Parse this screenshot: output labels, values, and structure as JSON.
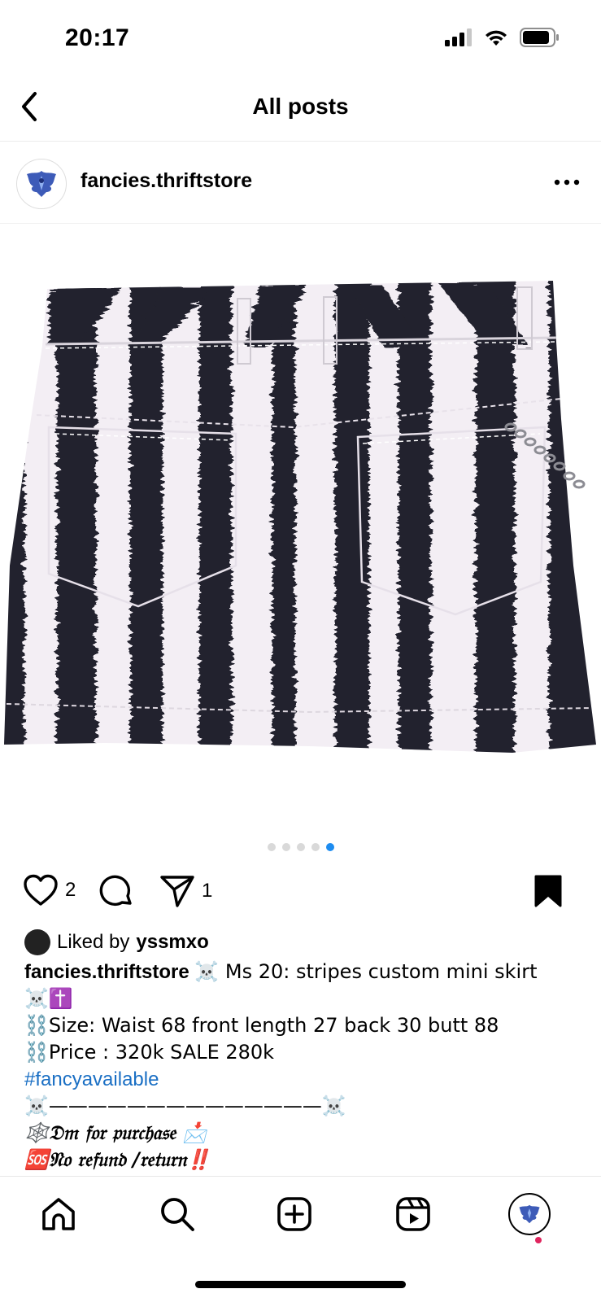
{
  "status": {
    "time": "20:17"
  },
  "header": {
    "title": "All posts"
  },
  "post": {
    "username": "fancies.thriftstore",
    "carousel": {
      "count": 5,
      "active_index": 4
    },
    "likes_count": "2",
    "shares_count": "1",
    "liked_by_prefix": "Liked by",
    "liked_by_user": "yssmxo"
  },
  "caption": {
    "username": "fancies.thriftstore",
    "line1": "☠️ Ms 20: stripes custom mini skirt",
    "line2": "☠️✝️",
    "line3": "⛓️Size: Waist 68 front length 27 back 30 butt 88",
    "line4": "⛓️Price : 320k SALE 280k",
    "hashtag": "#fancyavailable",
    "line6": "☠️——————————————☠️",
    "line7": "🕸️𝔇𝔪 𝔣𝔬𝔯 𝔭𝔲𝔯𝔠𝔥𝔞𝔰𝔢 📩",
    "line8": "🆘𝔑𝔬 𝔯𝔢𝔣𝔲𝔫𝔡 /𝔯𝔢𝔱𝔲𝔯𝔫‼️"
  },
  "icons": {
    "back": "chevron-left-icon",
    "more": "more-horizontal-icon",
    "like": "heart-icon",
    "comment": "comment-icon",
    "share": "send-icon",
    "save": "bookmark-icon",
    "home": "home-icon",
    "search": "search-icon",
    "create": "plus-square-icon",
    "reels": "reels-icon",
    "profile": "avatar"
  },
  "colors": {
    "link": "#1a6fc4",
    "active_dot": "#1d8cf0",
    "notification": "#e0245e"
  }
}
